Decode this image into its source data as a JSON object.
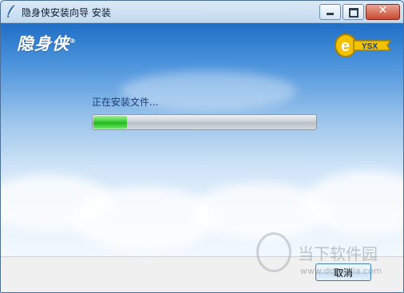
{
  "window": {
    "title": "隐身侠安装向导 安装"
  },
  "controls": {
    "close_glyph": "✕"
  },
  "brand": {
    "logo_text": "隐身侠",
    "logo_mark": "®",
    "right_logo_text": "YSX"
  },
  "install": {
    "status_text": "正在安装文件...",
    "progress_fraction": 0.15
  },
  "footer": {
    "cancel_label": "取消"
  },
  "watermark": {
    "text": "当下软件园",
    "sub": "www.downxia.com"
  }
}
